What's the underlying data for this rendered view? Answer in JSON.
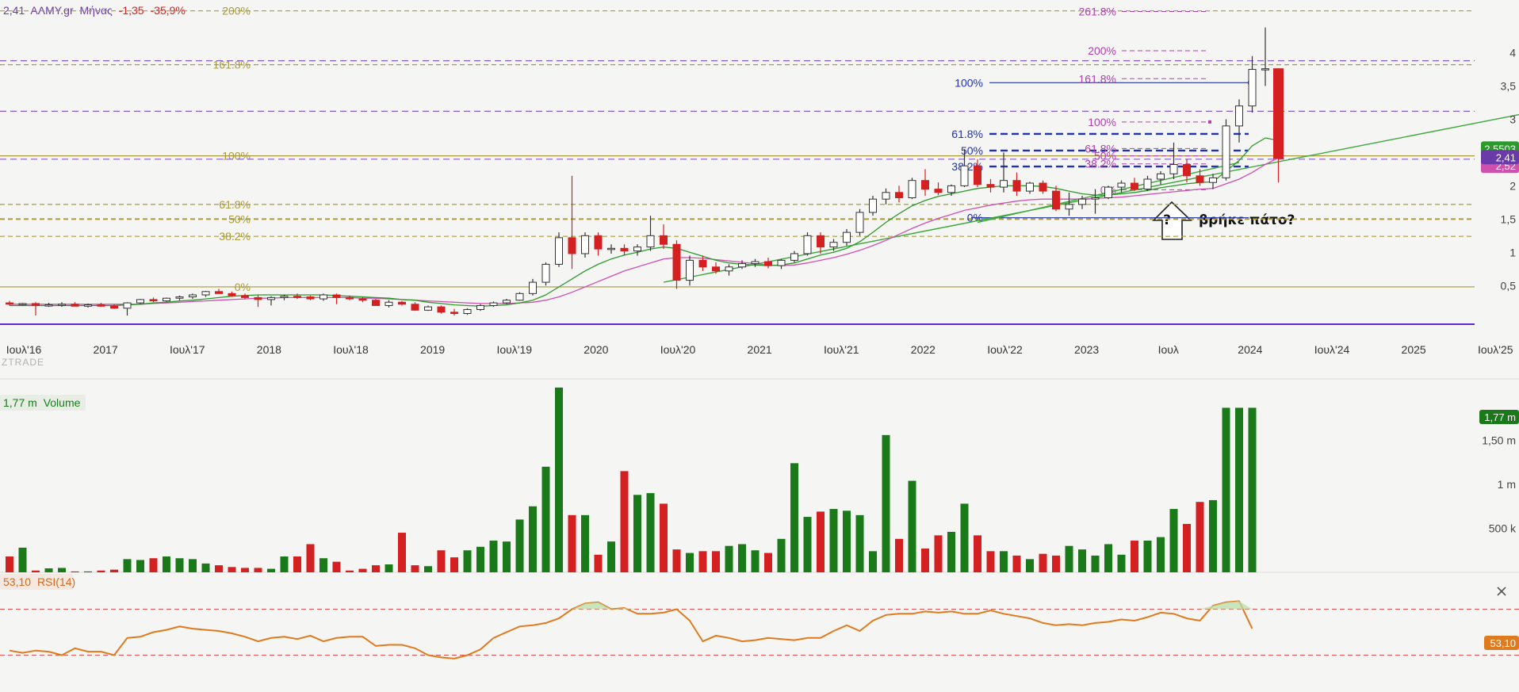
{
  "header": {
    "price": "2,41",
    "symbol": "ΑΛΜΥ.gr",
    "period": "Μήνας",
    "change": "-1,35",
    "change_pct": "-35,9%"
  },
  "watermark": "ZTRADE",
  "colors": {
    "up": "#1a7a1a",
    "down": "#d42020",
    "candle_up_fill": "#ffffff",
    "candle_outline": "#333333",
    "fib_gold": "#a89a3a",
    "fib_blue": "#2233aa",
    "fib_magenta": "#b040b0",
    "ma_green": "#2a9a2a",
    "ma_pink": "#d050b0",
    "trend_green": "#3aa83a",
    "purple_dash": "#8a5ad0",
    "rsi_line": "#e07a1e",
    "rsi_bands": "#e05050",
    "header_purple": "#6a3aa8",
    "header_red": "#d42020"
  },
  "chart_data": [
    {
      "type": "candlestick",
      "title": "",
      "x_labels": [
        "Ιουλ'16",
        "2017",
        "Ιουλ'17",
        "2018",
        "Ιουλ'18",
        "2019",
        "Ιουλ'19",
        "2020",
        "Ιουλ'20",
        "2021",
        "Ιουλ'21",
        "2022",
        "Ιουλ'22",
        "2023",
        "Ιουλ",
        "2024",
        "Ιουλ'24",
        "2025",
        "Ιουλ'25"
      ],
      "y_ticks": [
        "0,5",
        "1",
        "1,5",
        "2",
        "2,5",
        "3",
        "3,5",
        "4"
      ],
      "y_tick_values": [
        0.5,
        1,
        1.5,
        2,
        2.5,
        3,
        3.5,
        4
      ],
      "ylim": [
        -0.45,
        4.65
      ],
      "xlim_month_index": [
        0,
        120
      ],
      "ohlc": [
        [
          0.24,
          0.27,
          0.2,
          0.22
        ],
        [
          0.22,
          0.24,
          0.2,
          0.23
        ],
        [
          0.23,
          0.25,
          0.05,
          0.2
        ],
        [
          0.2,
          0.24,
          0.18,
          0.21
        ],
        [
          0.21,
          0.25,
          0.18,
          0.22
        ],
        [
          0.22,
          0.25,
          0.19,
          0.19
        ],
        [
          0.19,
          0.23,
          0.17,
          0.21
        ],
        [
          0.21,
          0.24,
          0.18,
          0.19
        ],
        [
          0.19,
          0.22,
          0.15,
          0.16
        ],
        [
          0.16,
          0.25,
          0.05,
          0.24
        ],
        [
          0.24,
          0.3,
          0.22,
          0.29
        ],
        [
          0.29,
          0.32,
          0.25,
          0.27
        ],
        [
          0.27,
          0.32,
          0.25,
          0.31
        ],
        [
          0.31,
          0.35,
          0.28,
          0.33
        ],
        [
          0.33,
          0.38,
          0.3,
          0.36
        ],
        [
          0.36,
          0.42,
          0.33,
          0.41
        ],
        [
          0.41,
          0.45,
          0.38,
          0.38
        ],
        [
          0.38,
          0.41,
          0.33,
          0.35
        ],
        [
          0.35,
          0.38,
          0.3,
          0.32
        ],
        [
          0.32,
          0.36,
          0.18,
          0.29
        ],
        [
          0.29,
          0.34,
          0.2,
          0.32
        ],
        [
          0.32,
          0.36,
          0.28,
          0.34
        ],
        [
          0.34,
          0.38,
          0.3,
          0.33
        ],
        [
          0.33,
          0.35,
          0.28,
          0.3
        ],
        [
          0.3,
          0.38,
          0.27,
          0.36
        ],
        [
          0.36,
          0.38,
          0.22,
          0.32
        ],
        [
          0.32,
          0.35,
          0.28,
          0.3
        ],
        [
          0.3,
          0.33,
          0.25,
          0.28
        ],
        [
          0.28,
          0.3,
          0.2,
          0.2
        ],
        [
          0.2,
          0.28,
          0.17,
          0.25
        ],
        [
          0.25,
          0.27,
          0.2,
          0.22
        ],
        [
          0.22,
          0.25,
          0.12,
          0.13
        ],
        [
          0.13,
          0.2,
          0.12,
          0.18
        ],
        [
          0.18,
          0.2,
          0.08,
          0.1
        ],
        [
          0.1,
          0.15,
          0.05,
          0.08
        ],
        [
          0.08,
          0.16,
          0.06,
          0.14
        ],
        [
          0.14,
          0.22,
          0.12,
          0.2
        ],
        [
          0.2,
          0.26,
          0.18,
          0.24
        ],
        [
          0.24,
          0.3,
          0.22,
          0.28
        ],
        [
          0.28,
          0.4,
          0.27,
          0.38
        ],
        [
          0.38,
          0.6,
          0.35,
          0.55
        ],
        [
          0.55,
          0.85,
          0.5,
          0.82
        ],
        [
          0.82,
          1.3,
          0.78,
          1.22
        ],
        [
          1.22,
          2.15,
          0.75,
          0.98
        ],
        [
          0.98,
          1.3,
          0.92,
          1.25
        ],
        [
          1.25,
          1.3,
          0.95,
          1.05
        ],
        [
          1.05,
          1.12,
          0.98,
          1.06
        ],
        [
          1.06,
          1.12,
          0.95,
          1.02
        ],
        [
          1.02,
          1.12,
          0.95,
          1.08
        ],
        [
          1.08,
          1.55,
          1.02,
          1.25
        ],
        [
          1.25,
          1.42,
          1.05,
          1.12
        ],
        [
          1.12,
          1.18,
          0.45,
          0.58
        ],
        [
          0.58,
          0.95,
          0.5,
          0.88
        ],
        [
          0.88,
          0.95,
          0.72,
          0.78
        ],
        [
          0.78,
          0.85,
          0.68,
          0.72
        ],
        [
          0.72,
          0.82,
          0.65,
          0.78
        ],
        [
          0.78,
          0.88,
          0.75,
          0.83
        ],
        [
          0.83,
          0.9,
          0.78,
          0.86
        ],
        [
          0.86,
          0.92,
          0.76,
          0.8
        ],
        [
          0.8,
          0.9,
          0.75,
          0.88
        ],
        [
          0.88,
          1.02,
          0.85,
          0.98
        ],
        [
          0.98,
          1.3,
          0.95,
          1.25
        ],
        [
          1.25,
          1.3,
          0.98,
          1.08
        ],
        [
          1.08,
          1.2,
          1.02,
          1.15
        ],
        [
          1.15,
          1.35,
          1.1,
          1.3
        ],
        [
          1.3,
          1.65,
          1.25,
          1.6
        ],
        [
          1.6,
          1.85,
          1.55,
          1.8
        ],
        [
          1.8,
          1.96,
          1.72,
          1.9
        ],
        [
          1.9,
          2.0,
          1.75,
          1.82
        ],
        [
          1.82,
          2.12,
          1.8,
          2.08
        ],
        [
          2.08,
          2.25,
          1.85,
          1.95
        ],
        [
          1.95,
          2.05,
          1.86,
          1.9
        ],
        [
          1.9,
          2.02,
          1.85,
          2.0
        ],
        [
          2.0,
          2.55,
          1.98,
          2.3
        ],
        [
          2.3,
          2.4,
          1.98,
          2.02
        ],
        [
          2.02,
          2.1,
          1.9,
          1.98
        ],
        [
          1.98,
          2.5,
          1.9,
          2.08
        ],
        [
          2.08,
          2.2,
          1.85,
          1.92
        ],
        [
          1.92,
          2.06,
          1.88,
          2.04
        ],
        [
          2.04,
          2.08,
          1.88,
          1.92
        ],
        [
          1.92,
          2.0,
          1.62,
          1.65
        ],
        [
          1.65,
          1.9,
          1.55,
          1.72
        ],
        [
          1.72,
          1.85,
          1.65,
          1.8
        ],
        [
          1.8,
          1.95,
          1.58,
          1.82
        ],
        [
          1.82,
          2.0,
          1.8,
          1.98
        ],
        [
          1.98,
          2.08,
          1.9,
          2.04
        ],
        [
          2.04,
          2.12,
          1.92,
          1.95
        ],
        [
          1.95,
          2.15,
          1.92,
          2.1
        ],
        [
          2.1,
          2.22,
          2.02,
          2.18
        ],
        [
          2.18,
          2.65,
          2.1,
          2.32
        ],
        [
          2.32,
          2.4,
          2.05,
          2.15
        ],
        [
          2.15,
          2.25,
          2.0,
          2.05
        ],
        [
          2.05,
          2.18,
          1.95,
          2.12
        ],
        [
          2.12,
          3.0,
          2.08,
          2.9
        ],
        [
          2.9,
          3.3,
          2.65,
          3.2
        ],
        [
          3.2,
          3.95,
          3.1,
          3.75
        ],
        [
          3.75,
          4.38,
          3.5,
          3.76
        ],
        [
          3.76,
          3.76,
          2.05,
          2.41
        ]
      ],
      "ma_fast": [
        0.2,
        0.2,
        0.2,
        0.2,
        0.2,
        0.2,
        0.2,
        0.2,
        0.2,
        0.21,
        0.22,
        0.24,
        0.25,
        0.27,
        0.28,
        0.3,
        0.32,
        0.34,
        0.35,
        0.36,
        0.36,
        0.36,
        0.36,
        0.36,
        0.36,
        0.35,
        0.34,
        0.33,
        0.32,
        0.31,
        0.29,
        0.28,
        0.25,
        0.23,
        0.21,
        0.2,
        0.19,
        0.2,
        0.21,
        0.24,
        0.28,
        0.36,
        0.48,
        0.6,
        0.72,
        0.82,
        0.9,
        0.96,
        1.0,
        1.05,
        1.08,
        1.06,
        1.0,
        0.94,
        0.88,
        0.84,
        0.82,
        0.81,
        0.8,
        0.81,
        0.84,
        0.9,
        0.96,
        1.0,
        1.06,
        1.16,
        1.3,
        1.45,
        1.58,
        1.7,
        1.78,
        1.84,
        1.88,
        1.92,
        1.96,
        1.98,
        2.0,
        2.0,
        2.0,
        1.99,
        1.96,
        1.92,
        1.88,
        1.86,
        1.86,
        1.88,
        1.9,
        1.93,
        1.97,
        2.0,
        2.03,
        2.05,
        2.06,
        2.22,
        2.38,
        2.6,
        2.72,
        2.68
      ],
      "ma_slow": [
        0.22,
        0.22,
        0.22,
        0.22,
        0.22,
        0.22,
        0.22,
        0.22,
        0.22,
        0.22,
        0.22,
        0.23,
        0.24,
        0.25,
        0.26,
        0.27,
        0.28,
        0.29,
        0.3,
        0.31,
        0.31,
        0.32,
        0.32,
        0.32,
        0.32,
        0.32,
        0.32,
        0.31,
        0.31,
        0.3,
        0.29,
        0.28,
        0.27,
        0.26,
        0.25,
        0.24,
        0.23,
        0.23,
        0.23,
        0.24,
        0.25,
        0.28,
        0.33,
        0.4,
        0.48,
        0.56,
        0.64,
        0.72,
        0.78,
        0.84,
        0.9,
        0.92,
        0.92,
        0.91,
        0.89,
        0.87,
        0.85,
        0.83,
        0.81,
        0.8,
        0.81,
        0.84,
        0.88,
        0.92,
        0.97,
        1.03,
        1.1,
        1.18,
        1.27,
        1.36,
        1.44,
        1.51,
        1.57,
        1.63,
        1.67,
        1.71,
        1.74,
        1.77,
        1.79,
        1.8,
        1.8,
        1.8,
        1.8,
        1.81,
        1.82,
        1.83,
        1.85,
        1.87,
        1.89,
        1.91,
        1.93,
        1.95,
        1.96,
        2.03,
        2.1,
        2.2,
        2.32,
        2.42
      ],
      "badges": {
        "price": "2,41",
        "ma_fast": "2,5503",
        "ma_slow": "2,52"
      },
      "fib_gold": [
        {
          "label": "200%",
          "value": 4.63
        },
        {
          "label": "161.8%",
          "value": 3.82
        },
        {
          "label": "100%",
          "value": 2.45
        },
        {
          "label": "61.8%",
          "value": 1.72
        },
        {
          "label": "50%",
          "value": 1.5
        },
        {
          "label": "38.2%",
          "value": 1.24
        },
        {
          "label": "0%",
          "value": 0.48
        }
      ],
      "fib_blue": [
        {
          "label": "100%",
          "value": 3.55
        },
        {
          "label": "61.8%",
          "value": 2.78
        },
        {
          "label": "50%",
          "value": 2.53
        },
        {
          "label": "38.2%",
          "value": 2.29
        },
        {
          "label": "0%",
          "value": 1.52
        }
      ],
      "fib_magenta": [
        {
          "label": "261.8%",
          "value": 4.62
        },
        {
          "label": "200%",
          "value": 4.03
        },
        {
          "label": "161.8%",
          "value": 3.61
        },
        {
          "label": "100%",
          "value": 2.96
        },
        {
          "label": "61.8%",
          "value": 2.56
        },
        {
          "label": "50%",
          "value": 2.45
        },
        {
          "label": "38.2%",
          "value": 2.33
        },
        {
          "label": "0%",
          "value": 1.94
        }
      ],
      "purple_levels": [
        3.88,
        3.12,
        2.4
      ],
      "purple_solid": -0.08,
      "annotation": {
        "question": "?",
        "text": "βρήκε πάτο?"
      }
    },
    {
      "type": "bar",
      "title": "Volume",
      "readout": "1,77 m",
      "y_ticks": [
        "500 k",
        "1 m",
        "1,50 m"
      ],
      "y_tick_values": [
        500000,
        1000000,
        1500000
      ],
      "ylim": [
        0,
        2000000
      ],
      "values": [
        180000,
        280000,
        20000,
        45000,
        50000,
        10000,
        10000,
        20000,
        30000,
        150000,
        140000,
        160000,
        180000,
        160000,
        150000,
        100000,
        80000,
        60000,
        50000,
        50000,
        40000,
        180000,
        180000,
        320000,
        160000,
        120000,
        20000,
        40000,
        80000,
        90000,
        450000,
        80000,
        70000,
        250000,
        170000,
        250000,
        290000,
        360000,
        350000,
        600000,
        750000,
        1200000,
        2100000,
        650000,
        650000,
        200000,
        350000,
        1150000,
        880000,
        900000,
        780000,
        260000,
        220000,
        240000,
        240000,
        300000,
        320000,
        250000,
        220000,
        380000,
        1240000,
        630000,
        690000,
        720000,
        700000,
        650000,
        240000,
        1560000,
        380000,
        1040000,
        270000,
        420000,
        460000,
        780000,
        420000,
        240000,
        240000,
        190000,
        150000,
        210000,
        190000,
        300000,
        260000,
        190000,
        320000,
        200000,
        360000,
        360000,
        400000,
        720000,
        550000,
        800000,
        820000,
        1870000,
        1870000,
        1870000
      ],
      "colors": "up-green/down-red per candle"
    },
    {
      "type": "line",
      "title": "RSI(14)",
      "readout": "53,10",
      "ylim": [
        0,
        100
      ],
      "bands": [
        70,
        30
      ],
      "values": [
        34,
        32,
        34,
        33,
        30,
        36,
        33,
        33,
        30,
        45,
        46,
        50,
        52,
        55,
        53,
        52,
        51,
        49,
        46,
        42,
        45,
        46,
        44,
        47,
        42,
        45,
        46,
        46,
        38,
        39,
        39,
        36,
        30,
        28,
        27,
        30,
        35,
        45,
        50,
        55,
        56,
        58,
        62,
        70,
        75,
        76,
        70,
        71,
        66,
        66,
        67,
        70,
        60,
        42,
        47,
        45,
        42,
        43,
        45,
        44,
        43,
        45,
        45,
        51,
        56,
        51,
        60,
        65,
        66,
        66,
        68,
        67,
        68,
        66,
        66,
        69,
        66,
        64,
        62,
        58,
        56,
        57,
        56,
        58,
        59,
        61,
        60,
        63,
        67,
        66,
        62,
        60,
        73,
        76,
        77,
        53
      ]
    }
  ]
}
